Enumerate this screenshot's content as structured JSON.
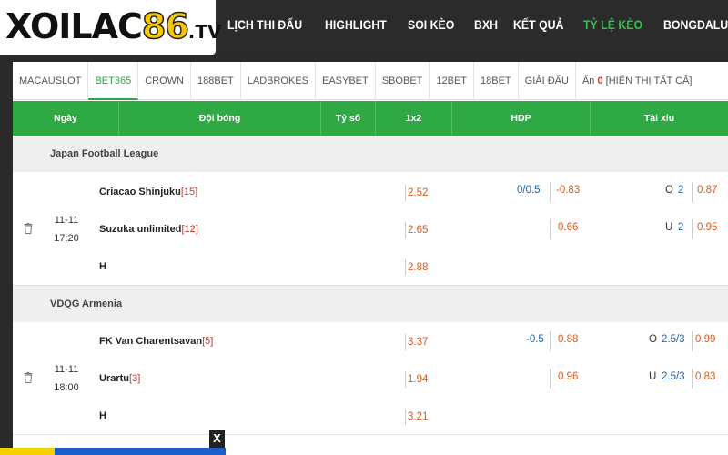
{
  "logo": {
    "part1": "XOILAC",
    "part2": "86",
    "part3": ".TV"
  },
  "nav": [
    "LỊCH THI ĐẤU",
    "HIGHLIGHT",
    "SOI KÈO",
    "BXH",
    "KẾT QUẢ",
    "TỶ LỆ KÈO",
    "BONGDALU VIP"
  ],
  "nav_active": "TỶ LỆ KÈO",
  "tabs": {
    "items": [
      "MACAUSLOT",
      "BET365",
      "CROWN",
      "188BET",
      "LADBROKES",
      "EASYBET",
      "SBOBET",
      "12BET",
      "18BET",
      "GIẢI ĐẤU"
    ],
    "active": "BET365",
    "hidden_label": "Ẩn",
    "hidden_count": "0",
    "show_all": "[HIỂN THỊ TẤT CẢ]"
  },
  "columns": {
    "date": "Ngày",
    "team": "Đội bóng",
    "score": "Tỷ số",
    "odds1x2": "1x2",
    "hdp": "HDP",
    "taixiu": "Tài xỉu"
  },
  "matches": [
    {
      "league": "Japan Football League",
      "date": "11-11",
      "time": "17:20",
      "home": {
        "name": "Criacao Shinjuku",
        "rank": "[15]",
        "odd": "2.52",
        "hdp_line": "0/0.5",
        "hdp_odd": "-0.83",
        "ou_side": "O",
        "ou_line": "2",
        "ou_odd": "0.87"
      },
      "away": {
        "name": "Suzuka unlimited",
        "rank": "[12]",
        "odd": "2.65",
        "hdp_odd": "0.66",
        "ou_side": "U",
        "ou_line": "2",
        "ou_odd": "0.95"
      },
      "draw": {
        "label": "H",
        "odd": "2.88"
      }
    },
    {
      "league": "VDQG Armenia",
      "date": "11-11",
      "time": "18:00",
      "home": {
        "name": "FK Van Charentsavan",
        "rank": "[5]",
        "odd": "3.37",
        "hdp_line": "-0.5",
        "hdp_odd": "0.88",
        "ou_side": "O",
        "ou_line": "2.5/3",
        "ou_odd": "0.99"
      },
      "away": {
        "name": "Urartu",
        "rank": "[3]",
        "odd": "1.94",
        "hdp_odd": "0.96",
        "ou_side": "U",
        "ou_line": "2.5/3",
        "ou_odd": "0.83"
      },
      "draw": {
        "label": "H",
        "odd": "3.21"
      }
    }
  ],
  "close_label": "X"
}
